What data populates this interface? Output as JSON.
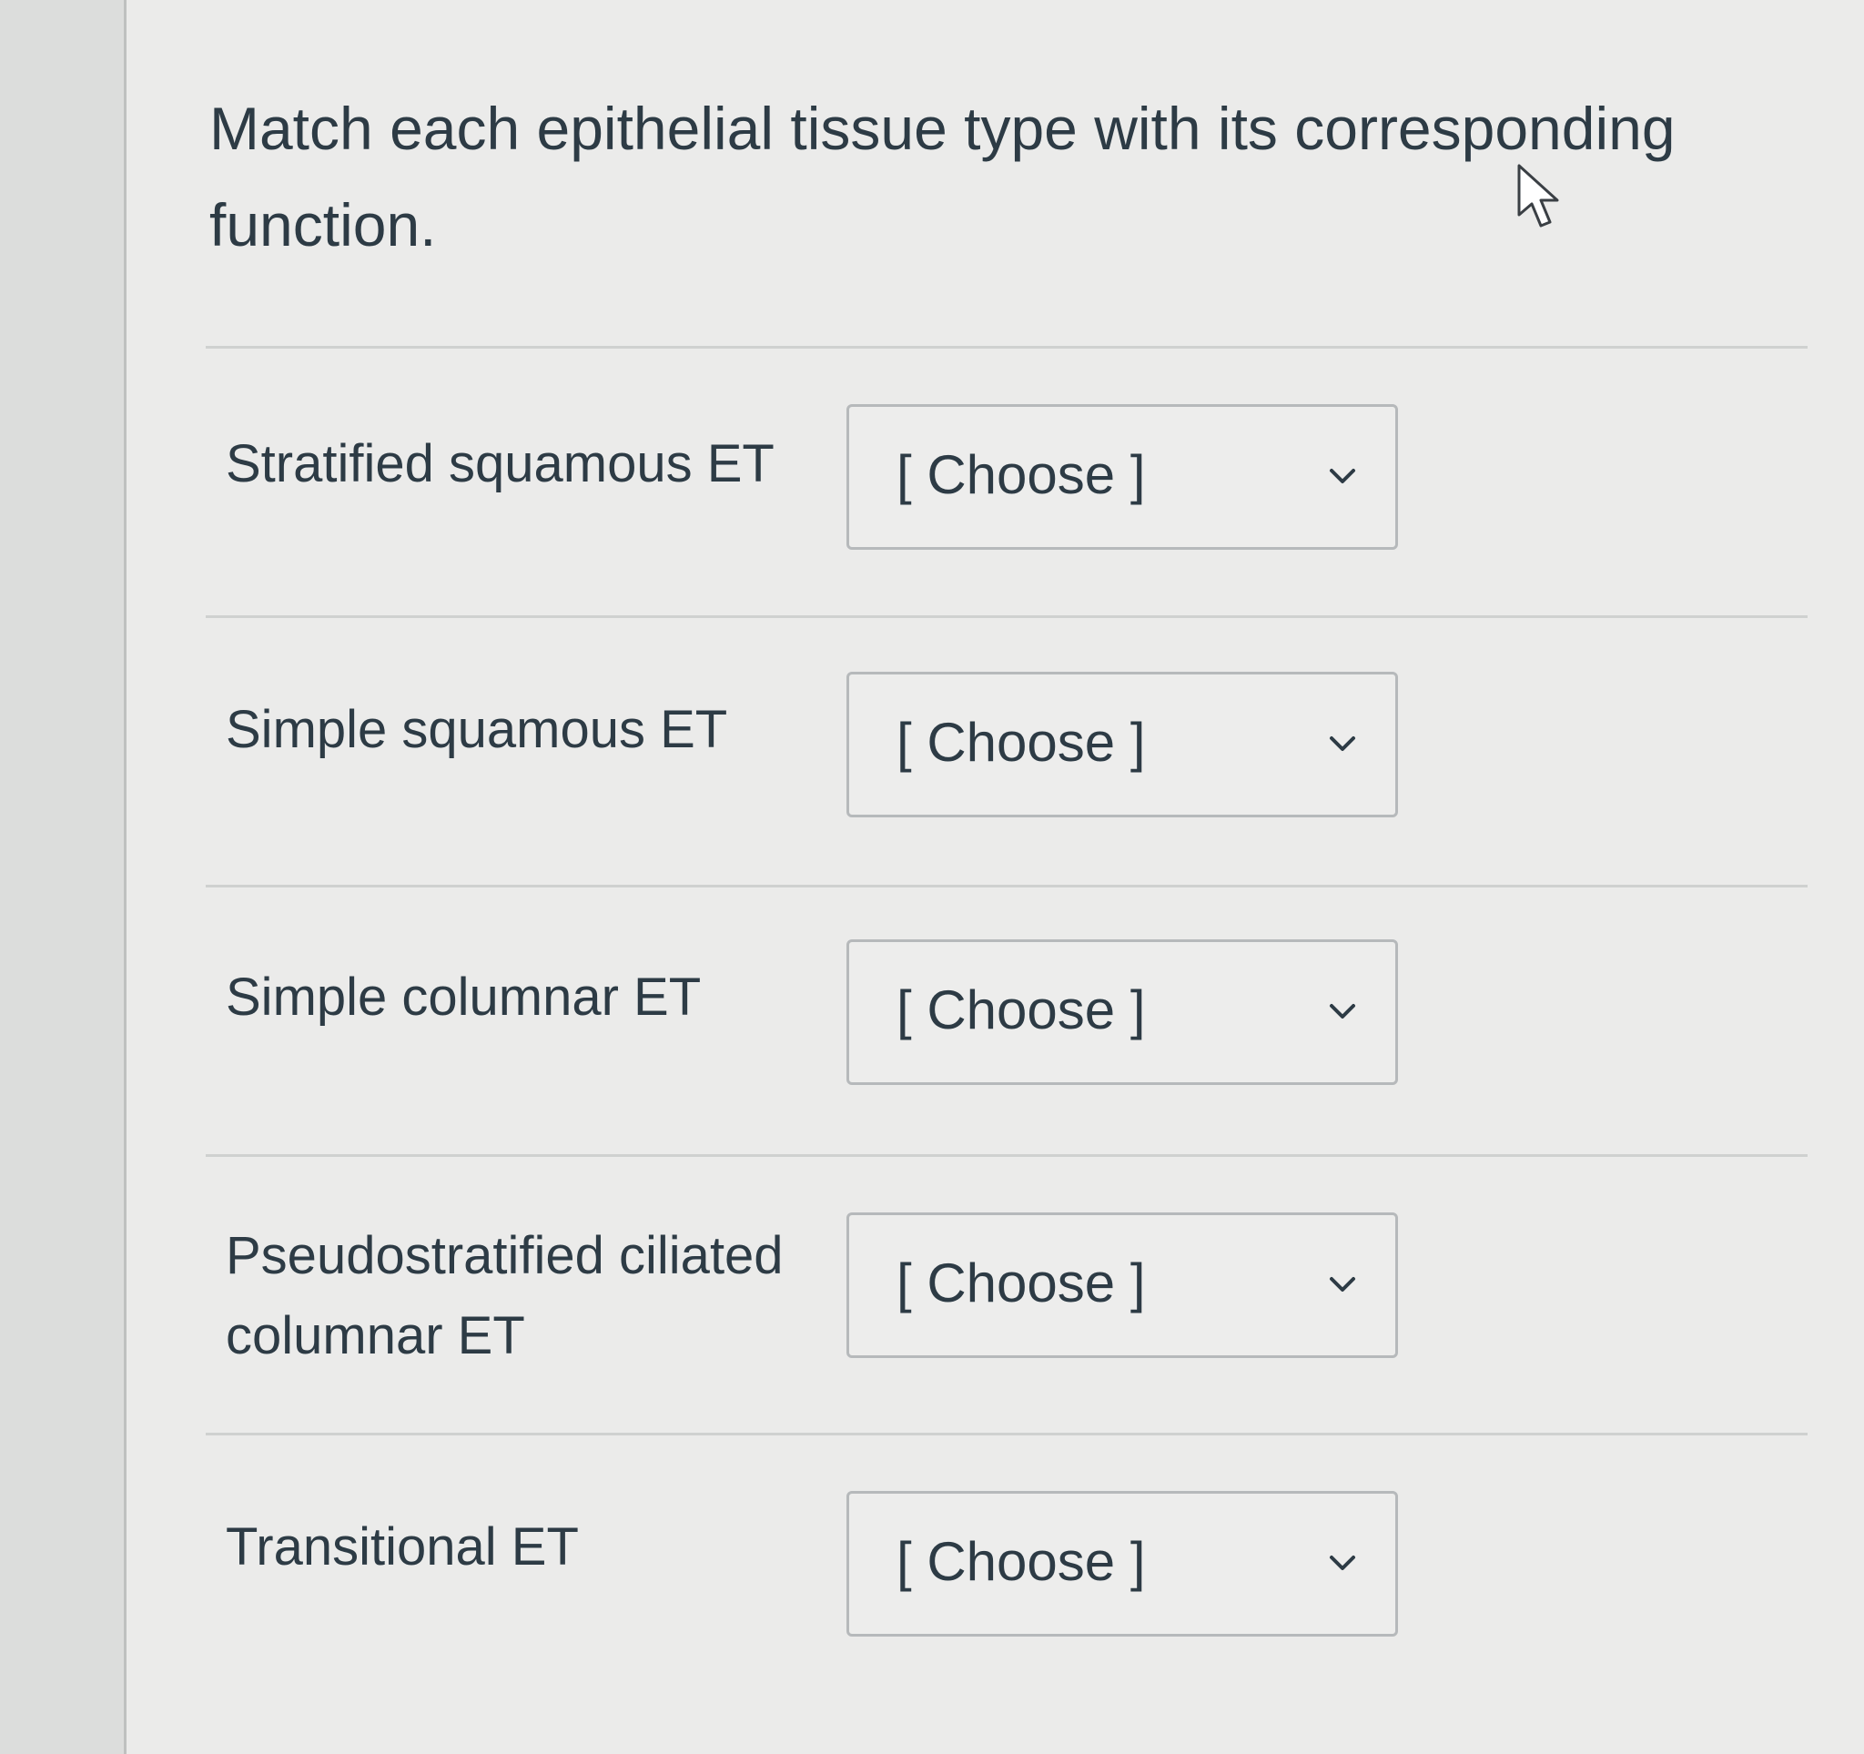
{
  "question": {
    "text": "Match each epithelial tissue type with its corresponding function."
  },
  "rows": [
    {
      "label": "Stratified squamous ET",
      "selected": "[ Choose ]",
      "icon": "chevron-down-icon"
    },
    {
      "label": "Simple squamous ET",
      "selected": "[ Choose ]",
      "icon": "chevron-down-icon"
    },
    {
      "label": "Simple columnar ET",
      "selected": "[ Choose ]",
      "icon": "chevron-down-icon"
    },
    {
      "label": "Pseudostratified ciliated columnar ET",
      "selected": "[ Choose ]",
      "icon": "chevron-down-icon"
    },
    {
      "label": "Transitional ET",
      "selected": "[ Choose ]",
      "icon": "chevron-down-icon"
    }
  ],
  "cursor": {
    "icon": "mouse-pointer-icon"
  }
}
